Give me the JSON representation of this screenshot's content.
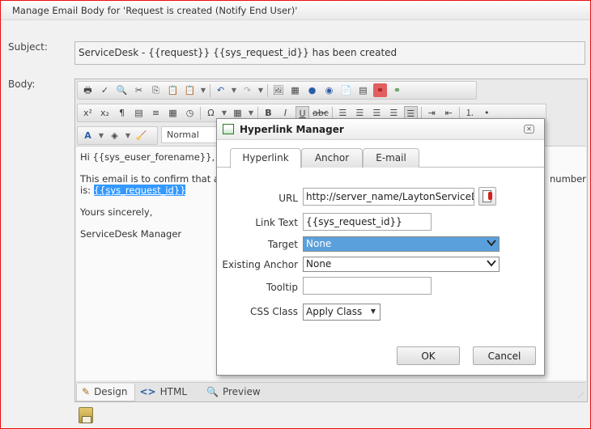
{
  "window": {
    "title": "Manage Email Body for 'Request is created (Notify End User)'"
  },
  "form": {
    "subject_label": "Subject:",
    "subject_value": "ServiceDesk - {{request}} {{sys_request_id}} has been created",
    "body_label": "Body:"
  },
  "editor": {
    "format_value": "Normal",
    "content": {
      "line1": "Hi {{sys_euser_forename}},",
      "line2_part1": "This email is to confirm that a",
      "line2_tail": "number",
      "line3_prefix": "is: ",
      "line3_link": "{{sys_request_id}}",
      "line4": "Yours sincerely,",
      "line5": "ServiceDesk Manager"
    },
    "modes": [
      "Design",
      "HTML",
      "Preview"
    ],
    "active_mode": "Design"
  },
  "dialog": {
    "title": "Hyperlink Manager",
    "tabs": [
      "Hyperlink",
      "Anchor",
      "E-mail"
    ],
    "active_tab": "Hyperlink",
    "fields": {
      "url_label": "URL",
      "url_value": "http://server_name/LaytonServiceDesk/",
      "link_text_label": "Link Text",
      "link_text_value": "{{sys_request_id}}",
      "target_label": "Target",
      "target_value": "None",
      "existing_anchor_label": "Existing Anchor",
      "existing_anchor_value": "None",
      "tooltip_label": "Tooltip",
      "tooltip_value": "",
      "css_class_label": "CSS Class",
      "css_class_value": "Apply Class"
    },
    "ok_label": "OK",
    "cancel_label": "Cancel"
  },
  "colors": {
    "selection": "#3399ff",
    "target_highlight": "#5aa0dc",
    "window_border": "#e81010"
  }
}
